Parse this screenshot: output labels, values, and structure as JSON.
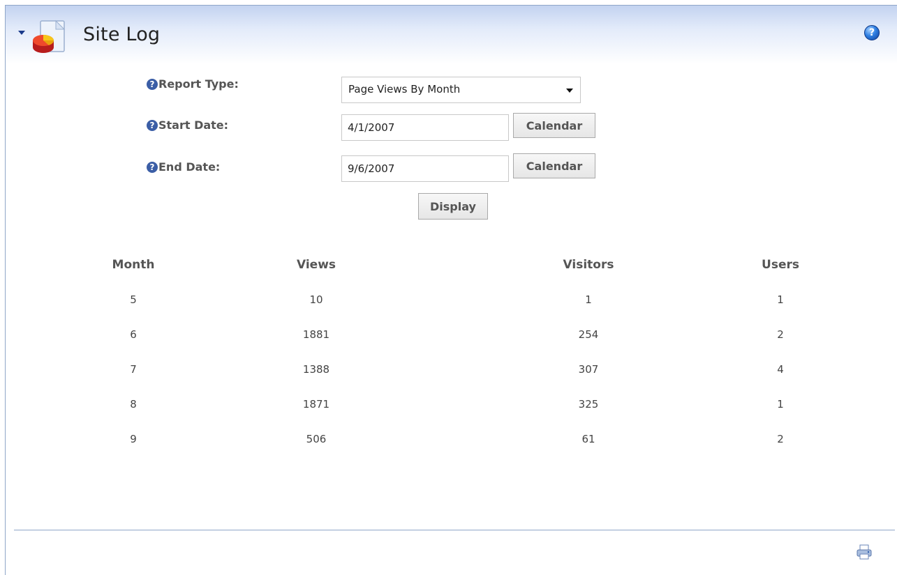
{
  "module": {
    "title": "Site Log",
    "collapse_icon": "chevron-down-icon",
    "module_icon": "pie-chart-document-icon",
    "help_icon": "help-icon"
  },
  "form": {
    "report_type_label": "Report Type:",
    "report_type_value": "Page Views By Month",
    "start_date_label": "Start Date:",
    "start_date_value": "4/1/2007",
    "end_date_label": "End Date:",
    "end_date_value": "9/6/2007",
    "calendar_label": "Calendar",
    "display_label": "Display",
    "help_glyph": "?"
  },
  "table": {
    "headers": [
      "Month",
      "Views",
      "Visitors",
      "Users"
    ],
    "rows": [
      [
        "5",
        "10",
        "1",
        "1"
      ],
      [
        "6",
        "1881",
        "254",
        "2"
      ],
      [
        "7",
        "1388",
        "307",
        "4"
      ],
      [
        "8",
        "1871",
        "325",
        "1"
      ],
      [
        "9",
        "506",
        "61",
        "2"
      ]
    ]
  },
  "footer": {
    "print_icon": "print-icon"
  },
  "colors": {
    "accent": "#3b5ea6",
    "border": "#8fa6c8",
    "title_gradient_top": "#c3d3f0"
  }
}
